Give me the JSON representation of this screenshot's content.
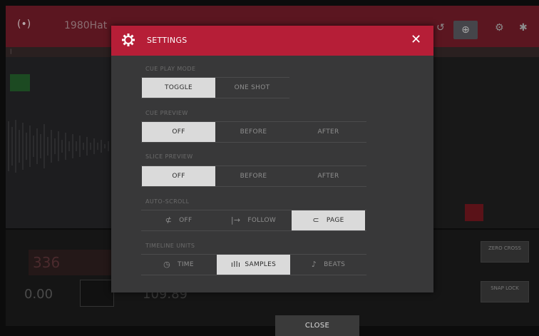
{
  "app": {
    "title": "1980Hat",
    "readout_top": "336",
    "readout_bottom_left": "0.00",
    "readout_bottom_mid": "109.89",
    "side_button_1": "ZERO CROSS",
    "side_button_2": "SNAP LOCK"
  },
  "settings": {
    "title": "SETTINGS",
    "sections": [
      {
        "label": "CUE PLAY MODE",
        "options": [
          "TOGGLE",
          "ONE SHOT"
        ],
        "selected": 0
      },
      {
        "label": "CUE PREVIEW",
        "options": [
          "OFF",
          "BEFORE",
          "AFTER"
        ],
        "selected": 0
      },
      {
        "label": "SLICE PREVIEW",
        "options": [
          "OFF",
          "BEFORE",
          "AFTER"
        ],
        "selected": 0
      },
      {
        "label": "AUTO-SCROLL",
        "options": [
          "OFF",
          "FOLLOW",
          "PAGE"
        ],
        "selected": 2
      },
      {
        "label": "TIMELINE UNITS",
        "options": [
          "TIME",
          "SAMPLES",
          "BEATS"
        ],
        "selected": 1
      }
    ],
    "close_label": "CLOSE"
  },
  "icons": {
    "settings": "gear-icon",
    "close": "close-icon",
    "scroll_off": "no-scroll-icon",
    "scroll_follow": "arrow-right-icon",
    "scroll_page": "page-return-icon",
    "time": "clock-icon",
    "samples": "waveform-icon",
    "beats": "music-note-icon"
  },
  "colors": {
    "accent": "#b61e37",
    "selected_option": "#dadada",
    "modal_bg": "#383839"
  }
}
